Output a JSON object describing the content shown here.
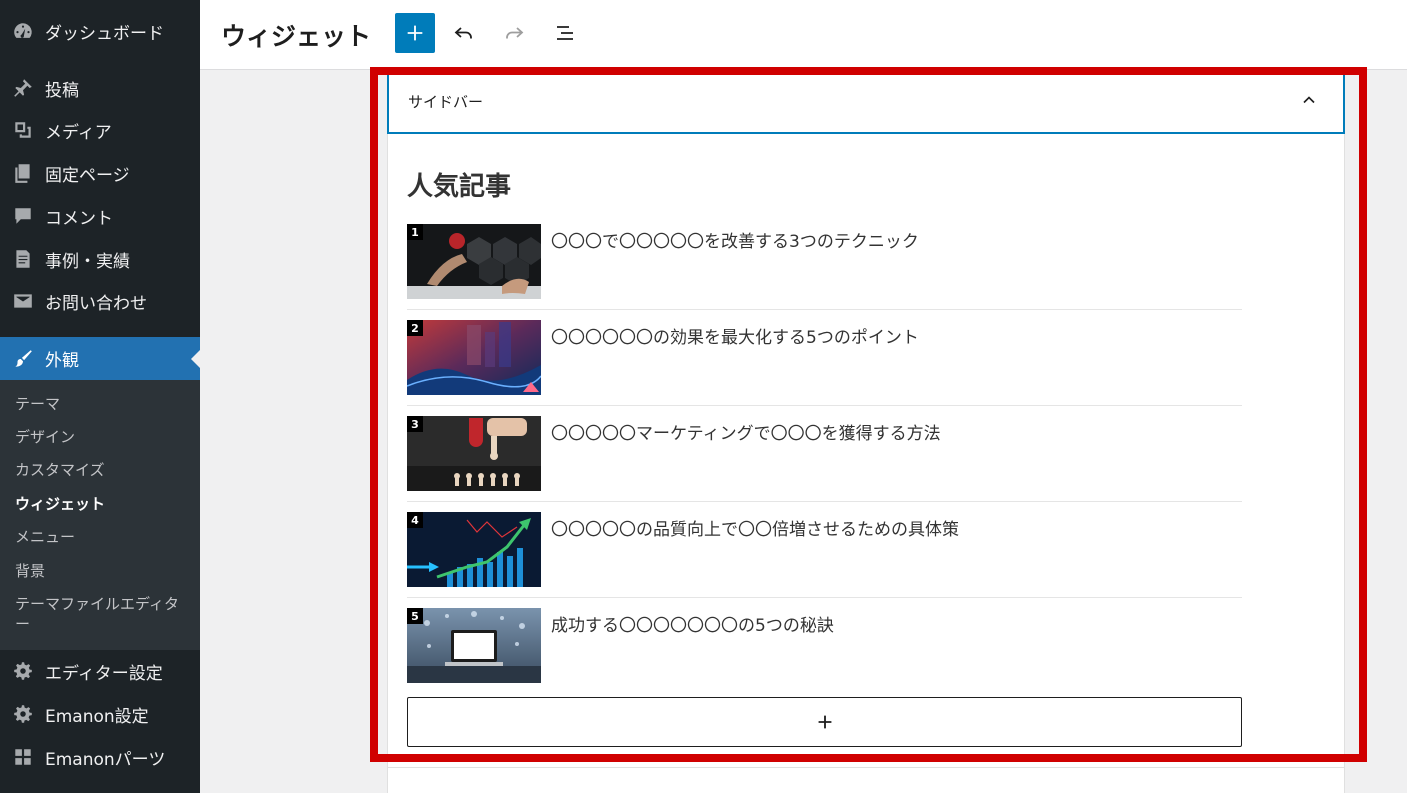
{
  "sidebar": {
    "items": [
      {
        "label": "ダッシュボード",
        "icon": "dashboard-icon"
      },
      {
        "label": "投稿",
        "icon": "pin-icon"
      },
      {
        "label": "メディア",
        "icon": "media-icon"
      },
      {
        "label": "固定ページ",
        "icon": "pages-icon"
      },
      {
        "label": "コメント",
        "icon": "comment-icon"
      },
      {
        "label": "事例・実績",
        "icon": "document-icon"
      },
      {
        "label": "お問い合わせ",
        "icon": "mail-icon"
      },
      {
        "label": "外観",
        "icon": "paintbrush-icon"
      }
    ],
    "submenu": [
      "テーマ",
      "デザイン",
      "カスタマイズ",
      "ウィジェット",
      "メニュー",
      "背景",
      "テーマファイルエディター"
    ],
    "bottom_items": [
      {
        "label": "エディター設定",
        "icon": "gear-icon"
      },
      {
        "label": "Emanon設定",
        "icon": "gear-icon"
      },
      {
        "label": "Emanonパーツ",
        "icon": "grid-icon"
      }
    ]
  },
  "header": {
    "title": "ウィジェット"
  },
  "panel": {
    "title": "サイドバー"
  },
  "widget": {
    "title": "人気記事",
    "posts": [
      {
        "rank": "1",
        "title": "〇〇〇で〇〇〇〇〇を改善する3つのテクニック"
      },
      {
        "rank": "2",
        "title": "〇〇〇〇〇〇の効果を最大化する5つのポイント"
      },
      {
        "rank": "3",
        "title": "〇〇〇〇〇マーケティングで〇〇〇を獲得する方法"
      },
      {
        "rank": "4",
        "title": "〇〇〇〇〇の品質向上で〇〇倍増させるための具体策"
      },
      {
        "rank": "5",
        "title": "成功する〇〇〇〇〇〇〇の5つの秘訣"
      }
    ]
  },
  "colors": {
    "sidebar_bg": "#1d2327",
    "submenu_bg": "#2c3338",
    "accent": "#2271b1",
    "add_button": "#007cba",
    "highlight": "#d00000"
  }
}
